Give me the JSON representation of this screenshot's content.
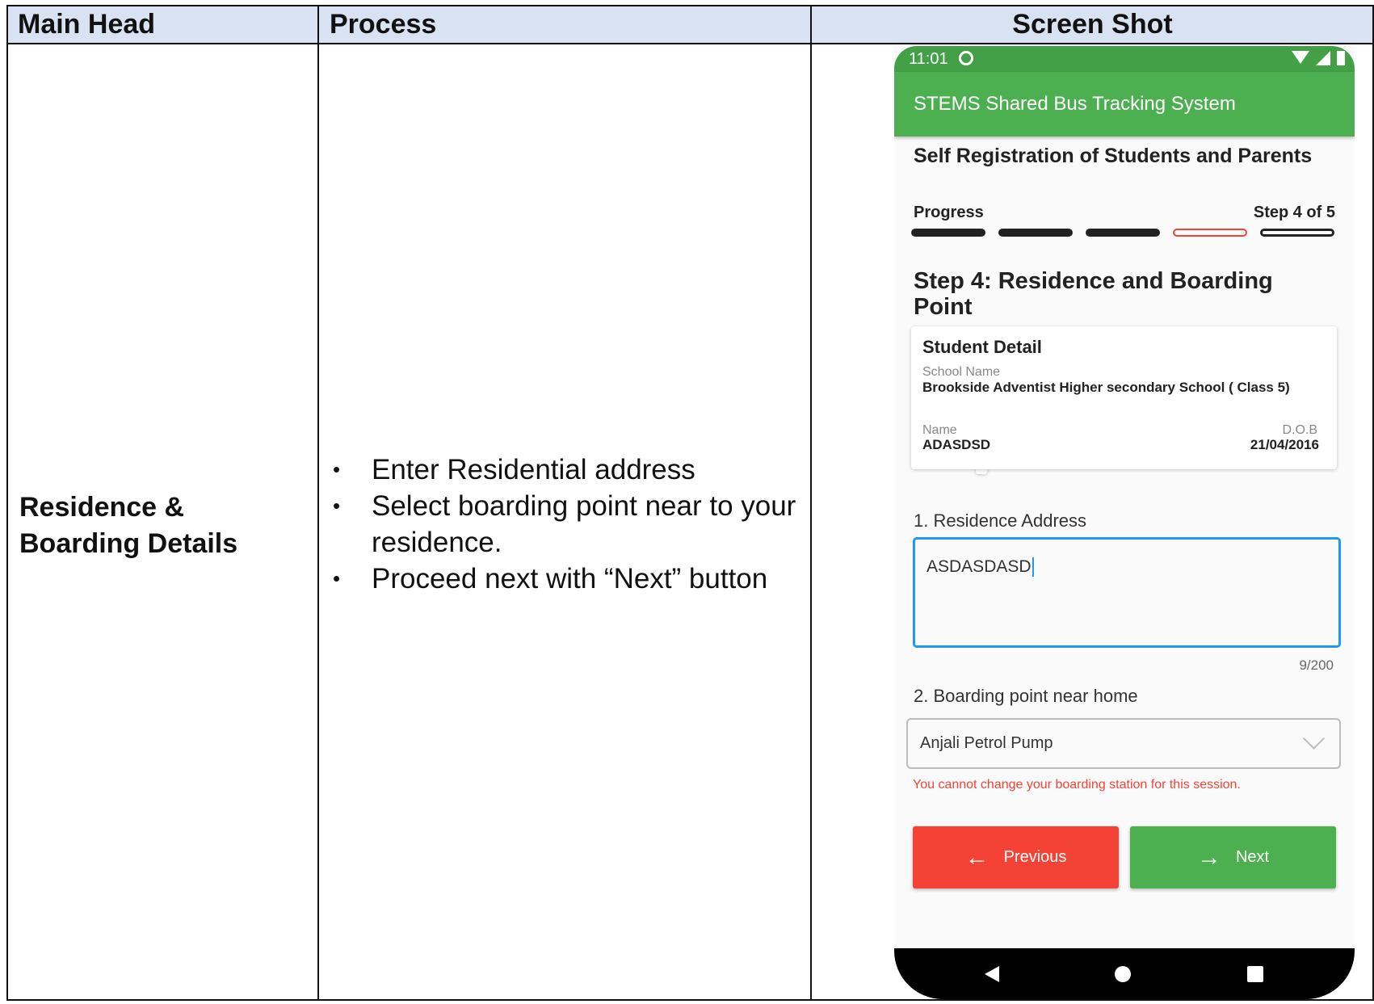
{
  "table": {
    "headers": [
      "Main Head",
      "Process",
      "Screen Shot"
    ],
    "main_head": "Residence & Boarding Details",
    "process_steps": [
      "Enter Residential address",
      "Select boarding point near to your residence.",
      "Proceed next with “Next” button"
    ]
  },
  "phone": {
    "status_time": "11:01",
    "app_title": "STEMS Shared Bus Tracking System",
    "page_title": "Self Registration of Students and Parents",
    "progress_label": "Progress",
    "step_label": "Step 4 of 5",
    "progress": {
      "current_step": 4,
      "total_steps": 5
    },
    "step_heading": "Step 4: Residence and Boarding Point",
    "student_detail": {
      "title": "Student Detail",
      "school_label": "School Name",
      "school_value": "Brookside Adventist Higher secondary School ( Class 5)",
      "name_label": "Name",
      "name_value": "ADASDSD",
      "dob_label": "D.O.B",
      "dob_value": "21/04/2016"
    },
    "residence_label": "1. Residence Address",
    "residence_value": "ASDASDASD",
    "residence_counter": "9/200",
    "boarding_label": "2. Boarding point near home",
    "boarding_value": "Anjali Petrol Pump",
    "boarding_error": "You cannot change your boarding station for this session.",
    "previous_label": "Previous",
    "next_label": "Next"
  },
  "colors": {
    "header_bg": "#d9e2f3",
    "app_green": "#4caf50",
    "error_red": "#f44336",
    "focus_blue": "#2196f3"
  }
}
